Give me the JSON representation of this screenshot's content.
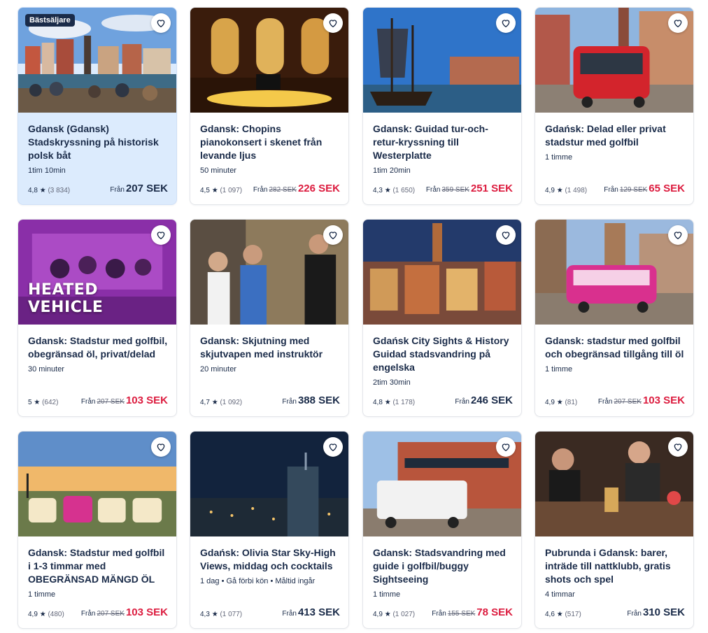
{
  "cards": [
    {
      "title": "Gdansk (Gdansk) Stadskryssning på historisk polsk båt",
      "duration": "1tim 10min",
      "rating": "4,8",
      "reviews": "(3 834)",
      "from": "Från",
      "old_price": "",
      "price": "207 SEK",
      "badge": "Bästsäljare",
      "overlay": ""
    },
    {
      "title": "Gdansk: Chopins pianokonsert i skenet från levande ljus",
      "duration": "50 minuter",
      "rating": "4,5",
      "reviews": "(1 097)",
      "from": "Från",
      "old_price": "282 SEK",
      "price": "226 SEK",
      "badge": "",
      "overlay": ""
    },
    {
      "title": "Gdansk: Guidad tur-och-retur-kryssning till Westerplatte",
      "duration": "1tim 20min",
      "rating": "4,3",
      "reviews": "(1 650)",
      "from": "Från",
      "old_price": "359 SEK",
      "price": "251 SEK",
      "badge": "",
      "overlay": ""
    },
    {
      "title": "Gdańsk: Delad eller privat stadstur med golfbil",
      "duration": "1 timme",
      "rating": "4,9",
      "reviews": "(1 498)",
      "from": "Från",
      "old_price": "129 SEK",
      "price": "65 SEK",
      "badge": "",
      "overlay": ""
    },
    {
      "title": "Gdansk: Stadstur med golfbil, obegränsad öl, privat/delad",
      "duration": "30 minuter",
      "rating": "5",
      "reviews": "(642)",
      "from": "Från",
      "old_price": "207 SEK",
      "price": "103 SEK",
      "badge": "",
      "overlay": "HEATED VEHICLE"
    },
    {
      "title": "Gdansk: Skjutning med skjutvapen med instruktör",
      "duration": "20 minuter",
      "rating": "4,7",
      "reviews": "(1 092)",
      "from": "Från",
      "old_price": "",
      "price": "388 SEK",
      "badge": "",
      "overlay": ""
    },
    {
      "title": "Gdańsk City Sights & History Guidad stadsvandring på engelska",
      "duration": "2tim 30min",
      "rating": "4,8",
      "reviews": "(1 178)",
      "from": "Från",
      "old_price": "",
      "price": "246 SEK",
      "badge": "",
      "overlay": ""
    },
    {
      "title": "Gdansk: stadstur med golfbil och obegränsad tillgång till öl",
      "duration": "1 timme",
      "rating": "4,9",
      "reviews": "(81)",
      "from": "Från",
      "old_price": "207 SEK",
      "price": "103 SEK",
      "badge": "",
      "overlay": ""
    },
    {
      "title": "Gdansk: Stadstur med golfbil i 1-3 timmar med OBEGRÄNSAD MÄNGD ÖL",
      "duration": "1 timme",
      "rating": "4,9",
      "reviews": "(480)",
      "from": "Från",
      "old_price": "207 SEK",
      "price": "103 SEK",
      "badge": "",
      "overlay": ""
    },
    {
      "title": "Gdańsk: Olivia Star Sky-High Views, middag och cocktails",
      "duration": "1 dag • Gå förbi kön • Måltid ingår",
      "rating": "4,3",
      "reviews": "(1 077)",
      "from": "Från",
      "old_price": "",
      "price": "413 SEK",
      "badge": "",
      "overlay": ""
    },
    {
      "title": "Gdansk: Stadsvandring med guide i golfbil/buggy Sightseeing",
      "duration": "1 timme",
      "rating": "4,9",
      "reviews": "(1 027)",
      "from": "Från",
      "old_price": "155 SEK",
      "price": "78 SEK",
      "badge": "",
      "overlay": ""
    },
    {
      "title": "Pubrunda i Gdansk: barer, inträde till nattklubb, gratis shots och spel",
      "duration": "4 timmar",
      "rating": "4,6",
      "reviews": "(517)",
      "from": "Från",
      "old_price": "",
      "price": "310 SEK",
      "badge": "",
      "overlay": ""
    }
  ],
  "colors": {
    "text": "#1a2b49",
    "sale": "#dc1b3e",
    "highlight": "#dcebfd",
    "badge": "#1a2b49"
  },
  "icons": {
    "wishlist": "heart-outline-icon",
    "rating": "star-icon"
  }
}
